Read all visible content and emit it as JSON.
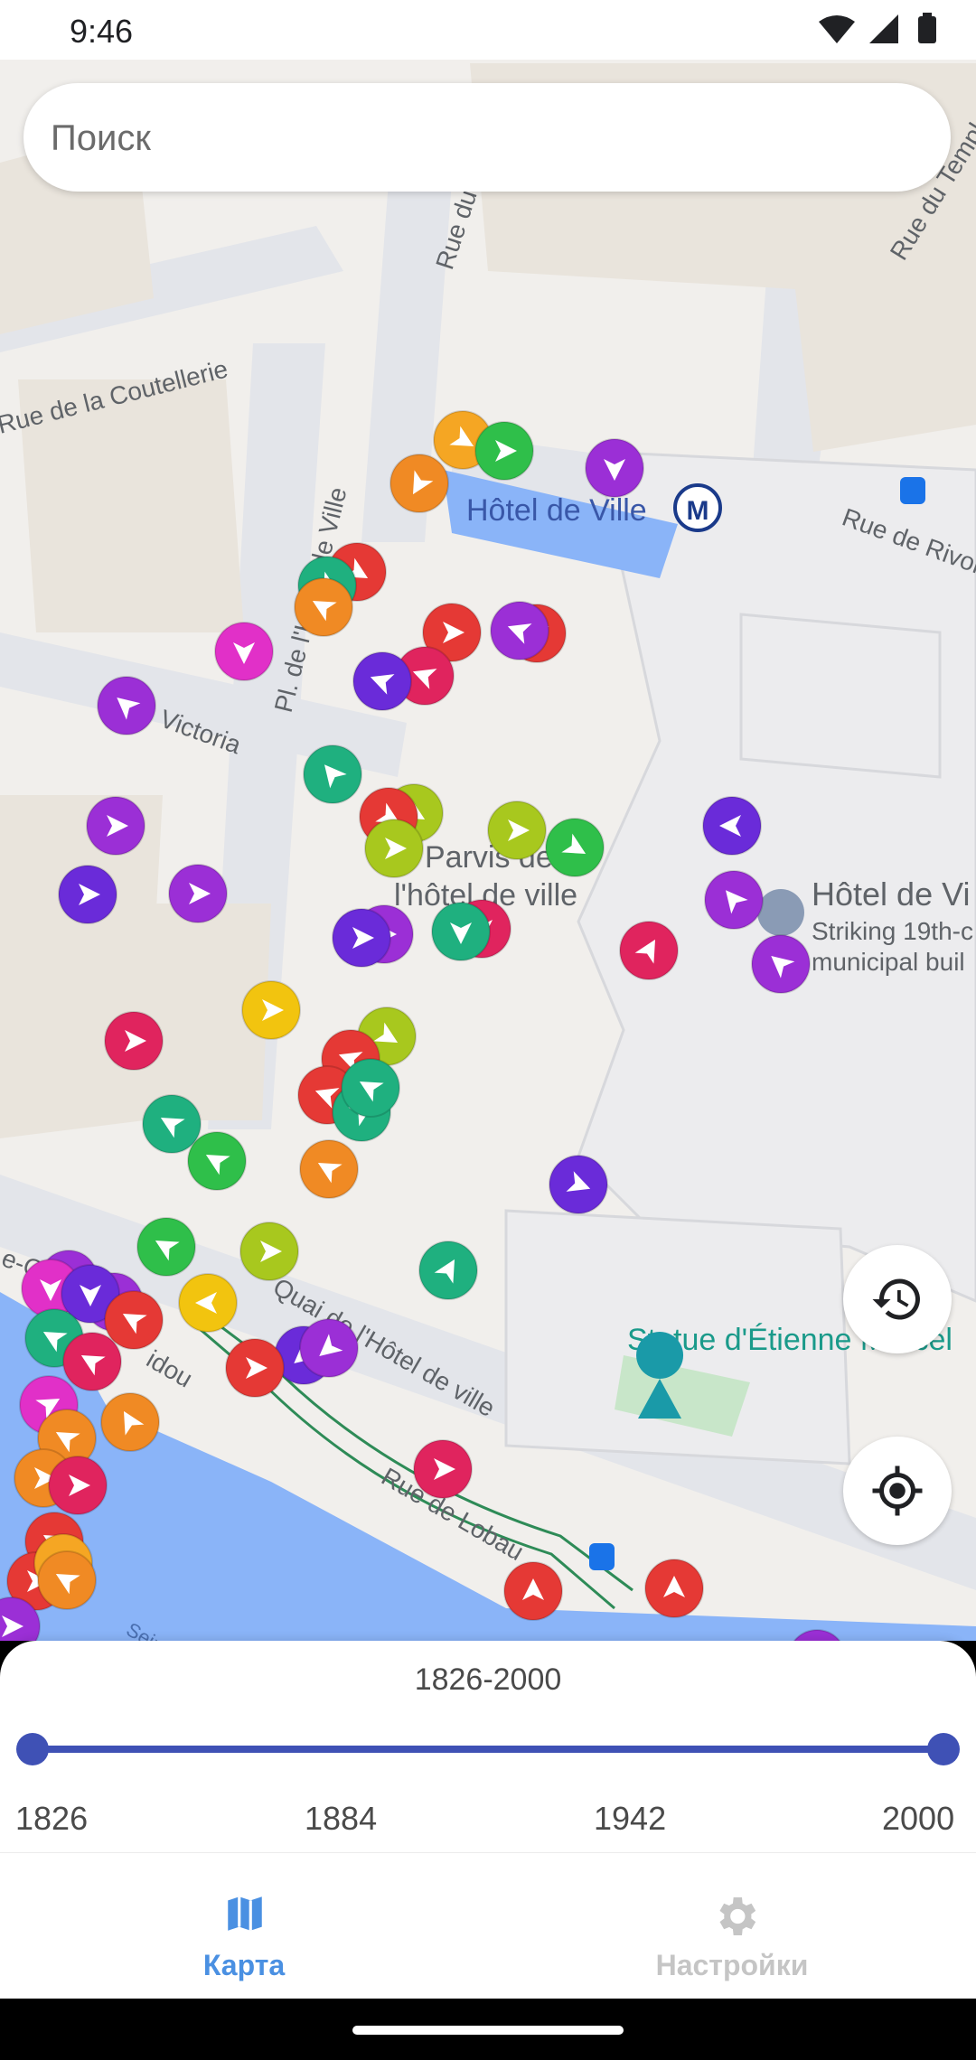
{
  "status_bar": {
    "time": "9:46"
  },
  "search": {
    "placeholder": "Поиск",
    "value": ""
  },
  "map": {
    "streets": [
      "Rue de la Coutellerie",
      "Rue du",
      "Rue du Temple",
      "Rue de Rivoli",
      "Pl. de l'Hôtel de Ville",
      "Victoria",
      "Quai de l'Hôtel de ville",
      "Rue de Lobau",
      "idou",
      "Seine",
      "e-Ge"
    ],
    "places": {
      "metro": "Hôtel de Ville",
      "parvis_line1": "Parvis de",
      "parvis_line2": "l'hôtel de ville",
      "hotel_title": "Hôtel de Vi",
      "hotel_desc1": "Striking 19th-c",
      "hotel_desc2": "municipal buil",
      "statue": "Statue d'Étienne Marcel"
    },
    "metro_badge": "M"
  },
  "marker_colors": {
    "red": "#e53935",
    "orange": "#f08a24",
    "amber": "#f5a623",
    "yellow": "#f2c40f",
    "lime": "#a8c81e",
    "green": "#2fbf4a",
    "teal": "#1fb07f",
    "pink": "#e0245e",
    "magenta": "#e130c8",
    "purple": "#9b2fd6",
    "violet": "#6a2bd9"
  },
  "timeline": {
    "range_label": "1826-2000",
    "min": 1826,
    "max": 2000,
    "selected_from": 1826,
    "selected_to": 2000,
    "ticks": [
      "1826",
      "1884",
      "1942",
      "2000"
    ],
    "accent_color": "#3f51b5"
  },
  "nav": {
    "map_label": "Карта",
    "settings_label": "Настройки",
    "active": "map",
    "active_color": "#4a90e2",
    "inactive_color": "#c5c5c5"
  }
}
